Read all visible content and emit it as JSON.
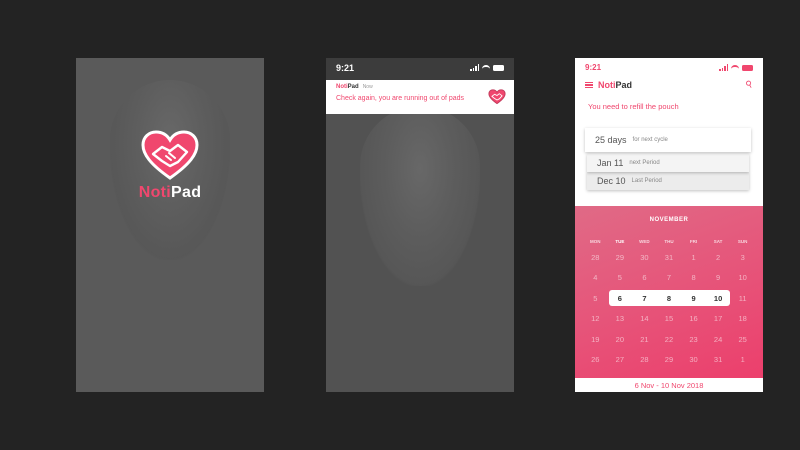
{
  "colors": {
    "accent": "#f0476e",
    "background": "#232323"
  },
  "splash": {
    "logo_accent": "Noti",
    "logo_rest": "Pad",
    "icon": "heart-handshake-icon"
  },
  "notification_screen": {
    "time": "9:21",
    "notification": {
      "app_accent": "Noti",
      "app_rest": "Pad",
      "time": "Now",
      "message": "Check again, you are running out of pads",
      "icon": "heart-handshake-icon"
    }
  },
  "main_screen": {
    "time": "9:21",
    "app_title_accent": "Noti",
    "app_title_rest": "Pad",
    "refill_message": "You need to refill the pouch",
    "cards": [
      {
        "value": "25 days",
        "label": "for next cycle"
      },
      {
        "value": "Jan 11",
        "label": "next Period"
      },
      {
        "value": "Dec 10",
        "label": "Last Period"
      }
    ],
    "calendar": {
      "month": "NOVEMBER",
      "weekdays": [
        "MON",
        "TUE",
        "WED",
        "THU",
        "FRI",
        "SAT",
        "SUN"
      ],
      "active_weekday": "TUE",
      "weeks": [
        [
          "28",
          "29",
          "30",
          "31",
          "1",
          "2",
          "3"
        ],
        [
          "4",
          "5",
          "6",
          "7",
          "8",
          "9",
          "10"
        ],
        [
          "5",
          "6",
          "7",
          "8",
          "9",
          "10",
          "11"
        ],
        [
          "12",
          "13",
          "14",
          "15",
          "16",
          "17",
          "18"
        ],
        [
          "19",
          "20",
          "21",
          "22",
          "23",
          "24",
          "25"
        ],
        [
          "26",
          "27",
          "28",
          "29",
          "30",
          "31",
          "1"
        ]
      ],
      "selected": [
        "6",
        "7",
        "8",
        "9",
        "10"
      ]
    },
    "range": "6 Nov - 10 Nov 2018"
  }
}
